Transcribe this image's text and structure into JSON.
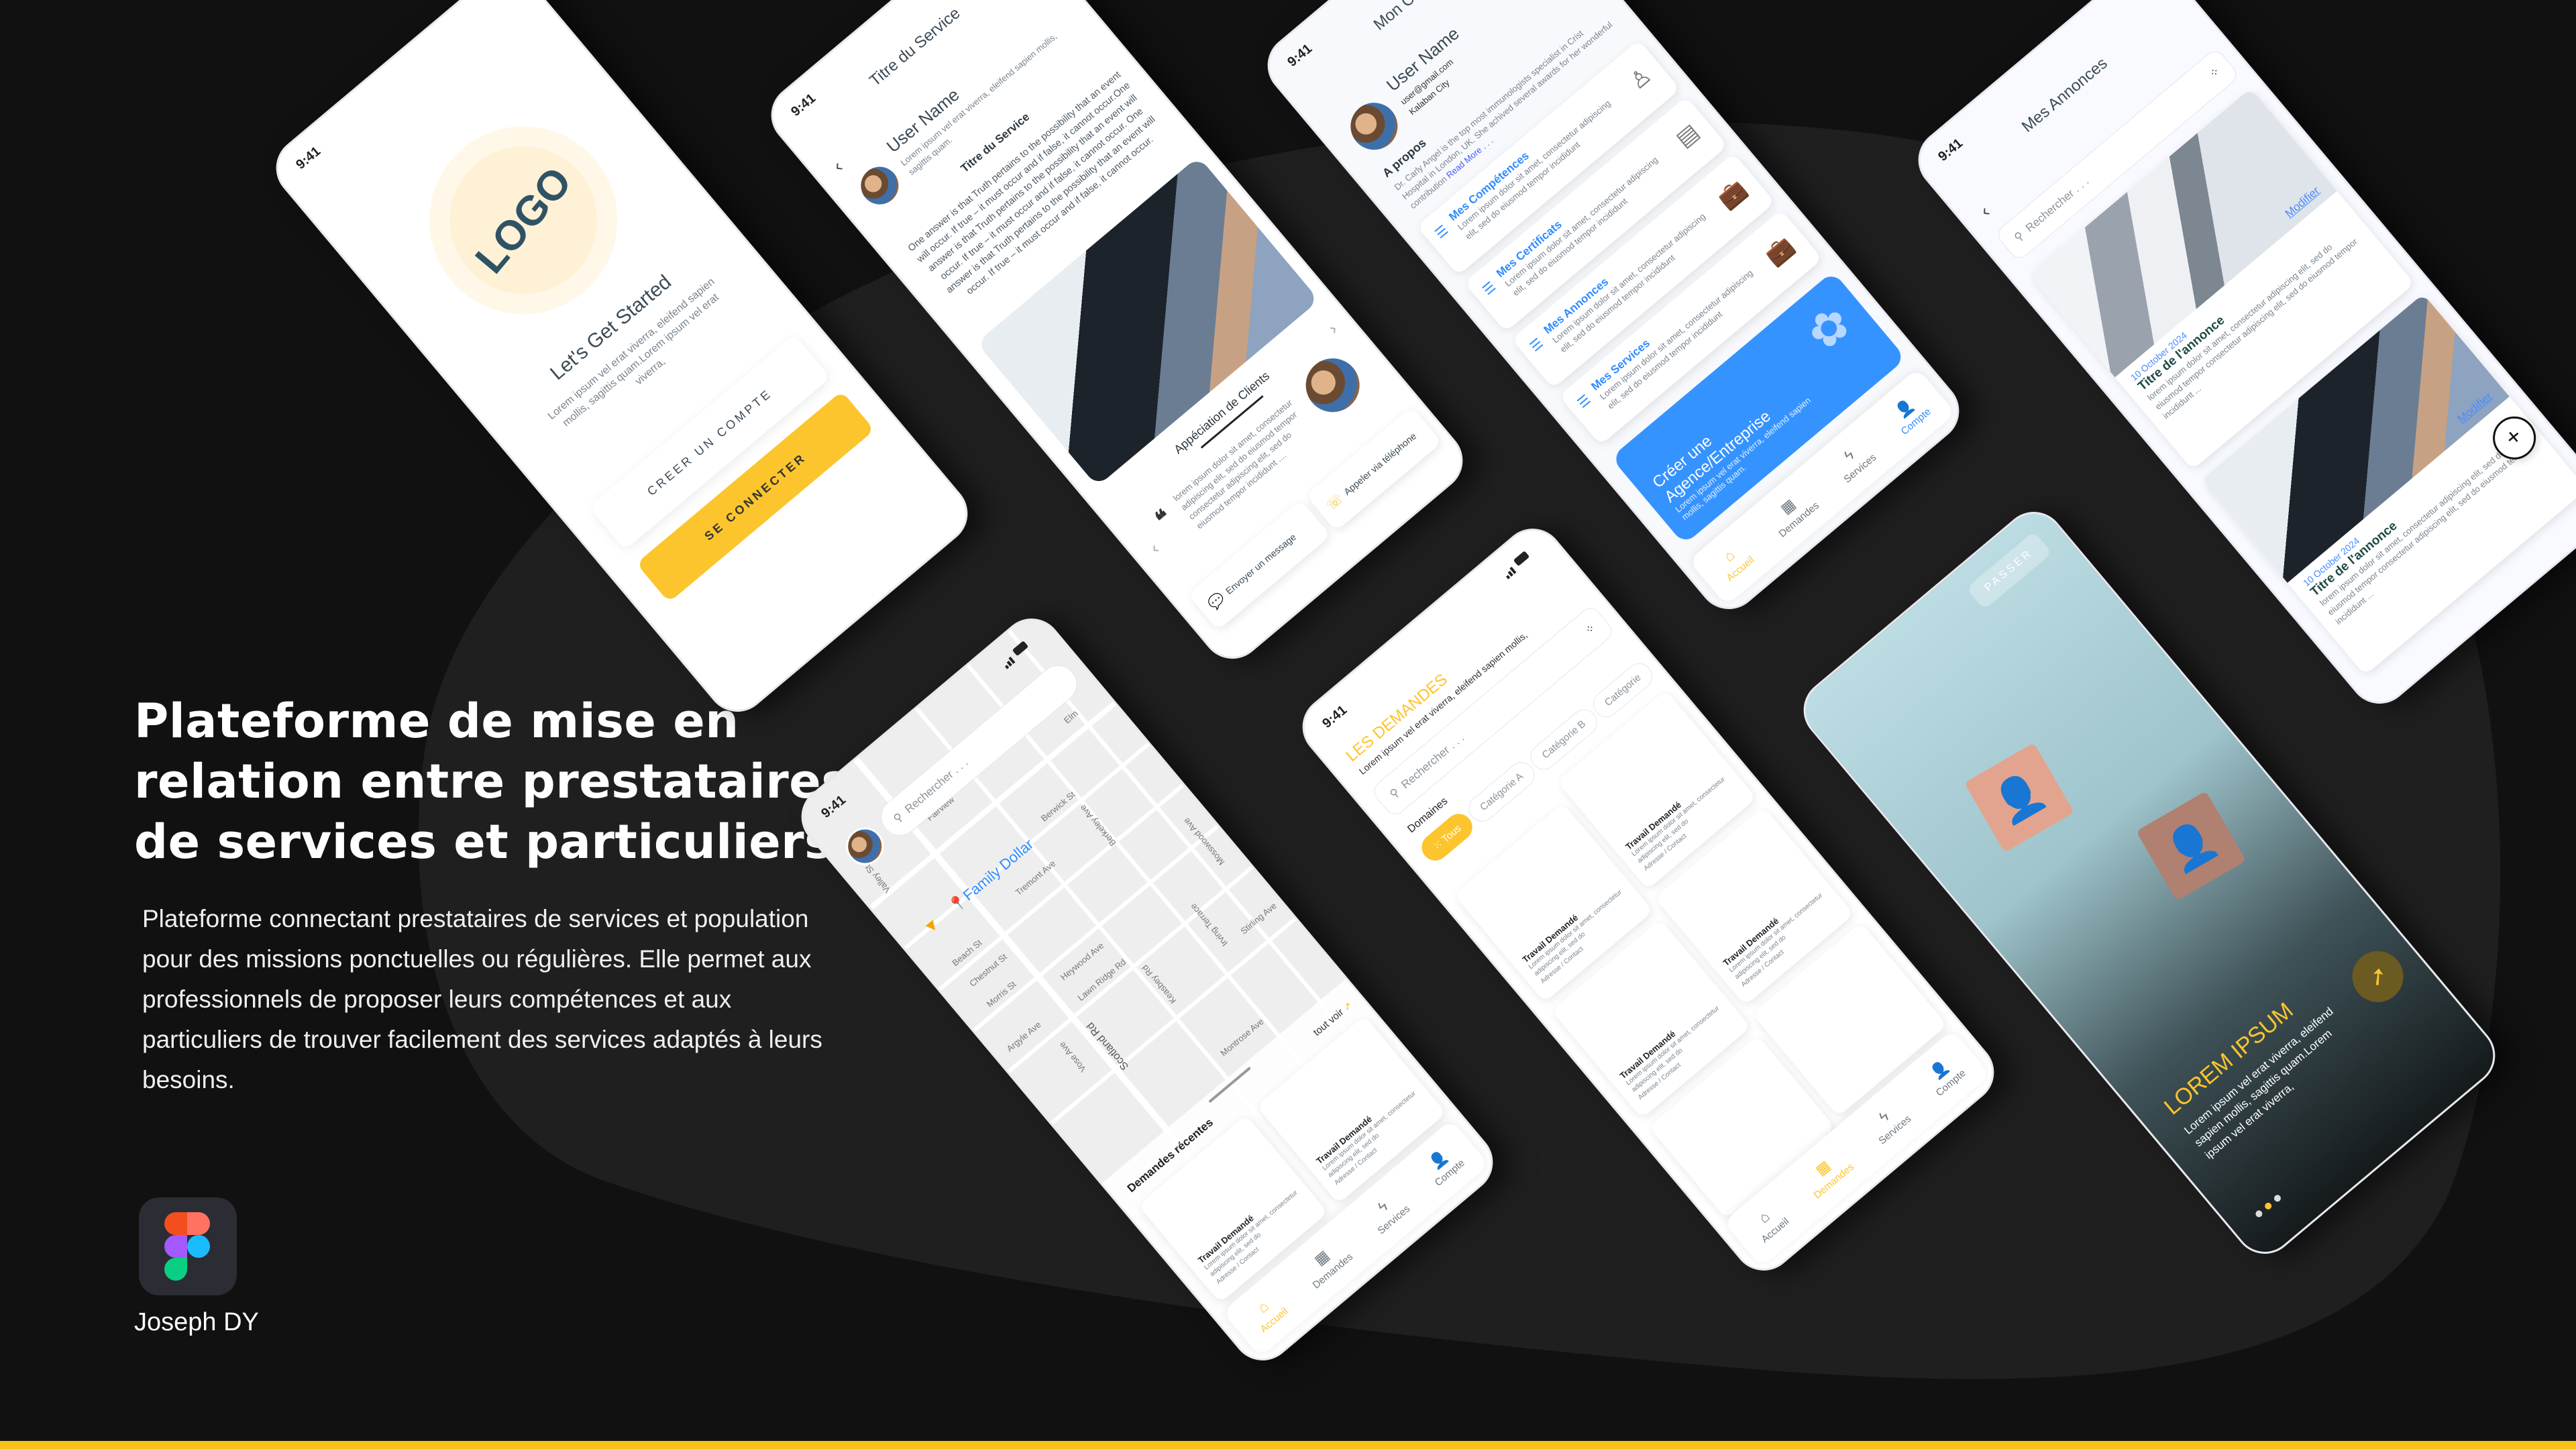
{
  "hero": {
    "title_lines": [
      "Plateforme de mise en",
      "relation entre prestataires",
      "de services et particuliers"
    ],
    "description": "Plateforme connectant prestataires de services et population pour des missions ponctuelles ou régulières. Elle permet aux professionnels de proposer leurs compétences et aux particuliers de trouver facilement des services adaptés à leurs besoins.",
    "tool_icon": "figma-logo",
    "author": "Joseph DY"
  },
  "colors": {
    "accent_yellow": "#fcc52d",
    "accent_blue": "#2f8cff",
    "background": "#111111",
    "blob": "#1f1f1f"
  },
  "status_time": "9:41",
  "login": {
    "logo": "LOGO",
    "heading": "Let's Get Started",
    "text": "Lorem ipsum vel erat viverra, eleifend sapien mollis, sagittis quam.Lorem ipsum vel erat viverra,",
    "create_account": "CREER UN COMPTE",
    "sign_in": "SE CONNECTER"
  },
  "service": {
    "title": "Titre du Service",
    "user_name": "User Name",
    "user_text": "Lorem ipsum vel erat viverra, eleifend sapien mollis, sagittis quam.",
    "subheading": "Titre du Service",
    "body": "One answer is that Truth pertains to the possibility that an event will occur. If true – it must occur and if false, it cannot occur.One answer is that Truth pertains to the possibility that an event will occur. If true – it must occur and if false, it cannot occur. One answer is that Truth pertains to the possibility that an event will occur. If true – it must occur and if false, it cannot occur.",
    "reviews_title": "Appéciation de Clients",
    "review_text": "lorem ipsum dolor sit amet, consectetur adipiscing elit, sed do eiusmod tempor consectetur adipiscing elit, sed do eiusmod tempor incididunt ....",
    "message_button": "Envoyer un message",
    "call_button": "Appeler via téléphone"
  },
  "account": {
    "title": "Mon Compte",
    "user_name": "User Name",
    "email": "user@gmail.com",
    "city": "Kalaban City",
    "about_title": "A propos",
    "about_text": "Dr. Carly Angel is the top most immunologists specialist in Crist Hospital in London, UK. She achived several awards for her wonderful contribution",
    "read_more": "Read More . . .",
    "sections": [
      {
        "title": "Mes Compétences",
        "text": "Lorem ipsum dolor sit amet, consectetur adipiscing elit, sed do eiusmod tempor incididunt"
      },
      {
        "title": "Mes Certificats",
        "text": "Lorem ipsum dolor sit amet, consectetur adipiscing elit, sed do eiusmod tempor incididunt"
      },
      {
        "title": "Mes Annonces",
        "text": "Lorem ipsum dolor sit amet, consectetur adipiscing elit, sed do eiusmod tempor incididunt"
      },
      {
        "title": "Mes Services",
        "text": "Lorem ipsum dolor sit amet, consectetur adipiscing elit, sed do eiusmod tempor incididunt"
      }
    ],
    "banner_title": "Créer une Agence/Entreprise",
    "banner_text": "Lorem ipsum vel erat viverra, eleifend sapien mollis, sagittis quam."
  },
  "nav": {
    "home": "Accueil",
    "requests": "Demandes",
    "services": "Services",
    "account": "Compte"
  },
  "annonces": {
    "title": "Mes Annonces",
    "search_placeholder": "Rechercher . . .",
    "items": [
      {
        "date": "10 October 2024",
        "title": "Titre de l'annonce",
        "text": "lorem ipsum dolor sit amet, consectetur adipiscing elit, sed do eiusmod tempor consectetur adipiscing elit, sed do eiusmod tempor incididunt ...",
        "action": "Modifier"
      },
      {
        "date": "10 October 2024",
        "title": "Titre de l'annonce",
        "text": "lorem ipsum dolor sit amet, consectetur adipiscing elit, sed do eiusmod tempor consectetur adipiscing elit, sed do eiusmod tempor incididunt ...",
        "action": "Modifier"
      }
    ]
  },
  "map": {
    "search_placeholder": "Rechercher . . .",
    "poi": "Family Dollar",
    "streets": [
      "Fairview",
      "Elm",
      "Berwick St",
      "Tremont Ave",
      "Beach St",
      "Chestnut St",
      "Morris St",
      "Heywood Ave",
      "Lawn Ridge Rd",
      "Argyle Ave",
      "Vose Ave",
      "Scotland Rd",
      "Keasbey Rd",
      "Berkeley Ave",
      "Irving Terrace",
      "Mosswood Ave",
      "Stirling Ave",
      "Montrose Ave",
      "Valley St"
    ],
    "recent_title": "Demandes récentes",
    "see_all": "tout voir",
    "card_title": "Travail Demandé",
    "card_text": "Lorem ipsum dolor sit amet, consectetur adipiscing elit, sed do",
    "card_meta": "Adresse / Contact"
  },
  "demandes": {
    "title": "LES DEMANDES",
    "subtitle": "Lorem ipsum vel erat viverra, eleifend sapien mollis,",
    "search_placeholder": "Rechercher . . .",
    "domains_label": "Domaines",
    "chips": [
      "Tous",
      "Catégorie A",
      "Catégorie B",
      "Catégorie"
    ],
    "card_title": "Travail Demandé",
    "card_text": "Lorem ipsum dolor sit amet, consectetur adipiscing elit, sed do",
    "card_meta": "Adresse / Contact"
  },
  "onboarding": {
    "skip": "PASSER",
    "title": "LOREM IPSUM",
    "text": "Lorem ipsum vel erat viverra, eleifend sapien mollis, sagittis quam.Lorem ipsum vel erat viverra,",
    "current_page": 2,
    "total_pages": 3
  }
}
